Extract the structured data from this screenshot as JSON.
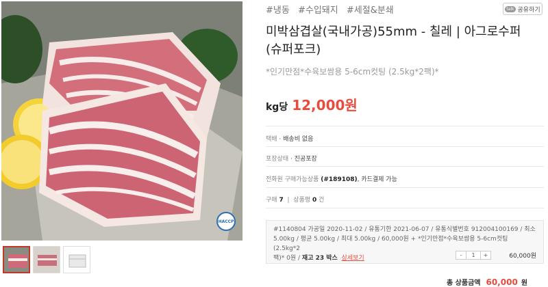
{
  "product": {
    "tags": [
      "#냉동",
      "#수입돼지",
      "#세절&분쇄"
    ],
    "share_label": "공유하기",
    "share_badge": "talk",
    "title_line1": "미박삼겹살(국내가공)55mm - 칠레 | 아그로수퍼",
    "title_line2": "(슈퍼포크)",
    "subtitle": "*인기만점*수육보쌈용 5-6cm컷팅 (2.5kg*2팩)*",
    "price_unit": "kg당",
    "price": "12,000원"
  },
  "details": {
    "shipping_key": "택배",
    "shipping_val": "배송비 없음",
    "pack_key": "포장상태",
    "pack_val": "진공포장",
    "phone_text": "전화원 구매가능상품",
    "phone_num": "(#189108)",
    "phone_rest": ", 카드결제 가능",
    "purchase_key": "구매",
    "purchase_count": "7",
    "review_key": "상품평",
    "review_count": "0",
    "review_unit": "건"
  },
  "option": {
    "line1": "#1140804  가공일 2020-11-02 / 유통기한 2021-06-07 / 유통식별번호 912004100169 / 최소",
    "line2": "5.00kg / 평균 5.00kg / 최대 5.00kg / 60,000원 + *인기만점*수육보쌈용 5-6cm컷팅 (2.5kg*2",
    "line3_a": "팩)* 0원 / ",
    "line3_b": "재고 23 박스",
    "detail_link": "상세보기",
    "qty": "1",
    "minus": "-",
    "plus": "+",
    "price": "60,000원"
  },
  "total": {
    "label": "총 상품금액",
    "amount": "60,000",
    "currency": "원"
  },
  "images": {
    "badge": "HACCP"
  },
  "colors": {
    "accent": "#e74c3c"
  }
}
